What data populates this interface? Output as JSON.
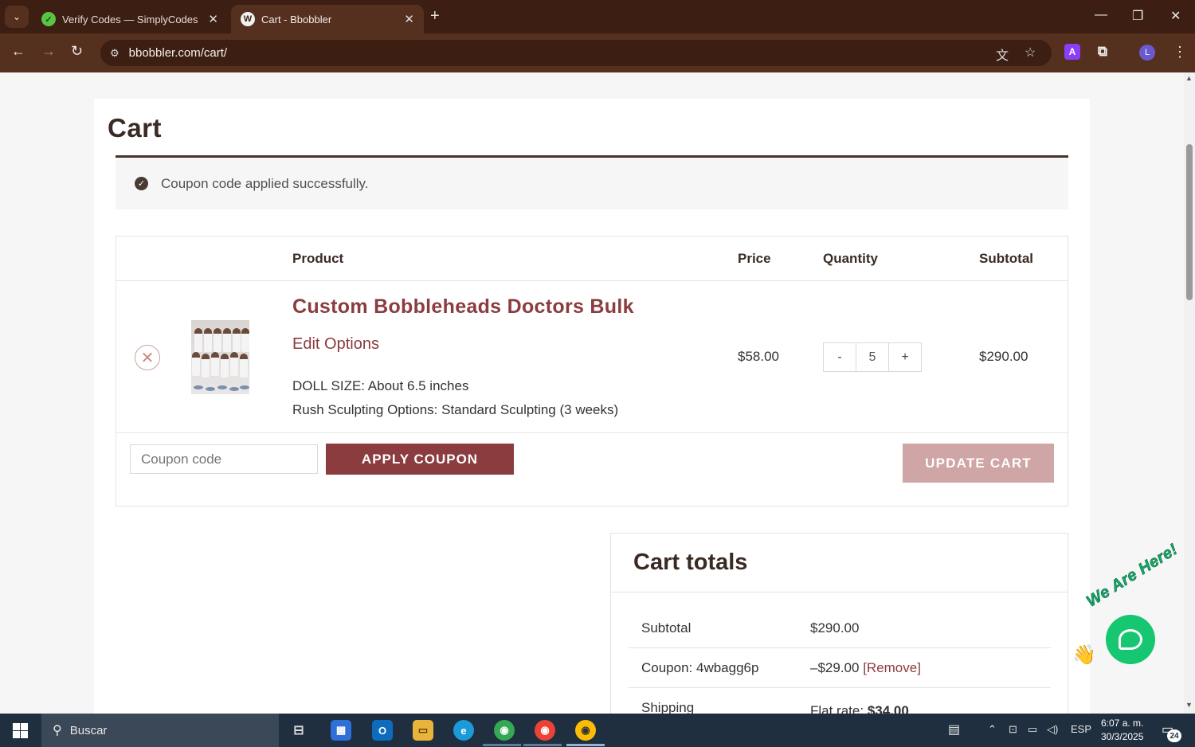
{
  "browser": {
    "tabs": [
      {
        "label": "Verify Codes — SimplyCodes",
        "active": false
      },
      {
        "label": "Cart - Bbobbler",
        "active": true
      }
    ],
    "url": "bbobbler.com/cart/",
    "profile_initial": "L",
    "extension_letter": "A"
  },
  "page": {
    "title": "Cart",
    "notice": "Coupon code applied successfully.",
    "table": {
      "headers": {
        "product": "Product",
        "price": "Price",
        "quantity": "Quantity",
        "subtotal": "Subtotal"
      },
      "items": [
        {
          "name": "Custom Bobbleheads Doctors Bulk",
          "edit_label": "Edit Options",
          "meta": [
            "DOLL SIZE: About 6.5 inches",
            "Rush Sculpting Options: Standard Sculpting (3 weeks)"
          ],
          "price": "$58.00",
          "quantity": "5",
          "subtotal": "$290.00"
        }
      ],
      "qty_minus": "-",
      "qty_plus": "+"
    },
    "coupon": {
      "placeholder": "Coupon code",
      "apply_label": "APPLY COUPON",
      "update_label": "UPDATE CART"
    },
    "totals": {
      "title": "Cart totals",
      "rows": [
        {
          "label": "Subtotal",
          "value": "$290.00"
        },
        {
          "label": "Coupon: 4wbagg6p",
          "value": "–$29.00",
          "link": "[Remove]"
        },
        {
          "label": "Shipping",
          "value_prefix": "Flat rate: ",
          "value": "$34.00"
        }
      ]
    },
    "chat": {
      "tagline": "We Are Here!"
    }
  },
  "taskbar": {
    "search_label": "Buscar",
    "lang": "ESP",
    "time": "6:07 a. m.",
    "date": "30/3/2025",
    "notifications": "24"
  },
  "colors": {
    "accent": "#8a3c3f",
    "update_disabled": "#cfa5a5",
    "chrome_dark": "#3c1f12",
    "chrome_mid": "#55301f",
    "chat_green": "#16c670"
  }
}
